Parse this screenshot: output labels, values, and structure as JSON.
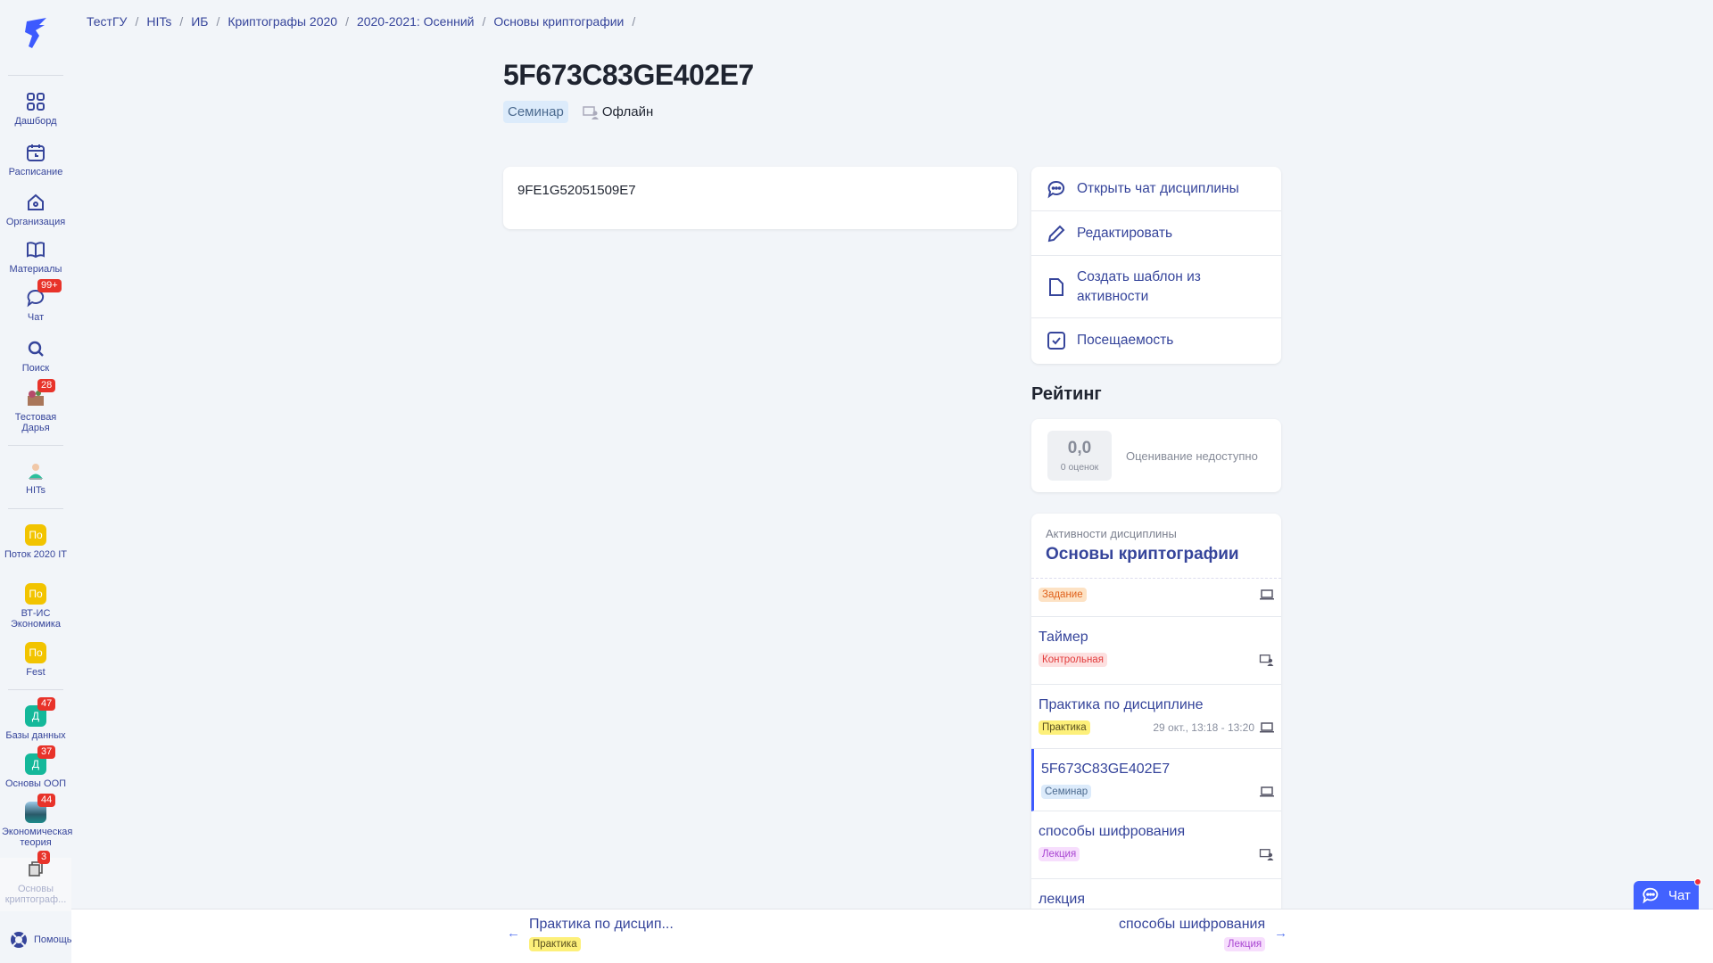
{
  "sidebar": {
    "items": [
      {
        "label": "Дашборд",
        "icon": "dashboard-icon"
      },
      {
        "label": "Расписание",
        "icon": "calendar-icon"
      },
      {
        "label": "Организация",
        "icon": "home-icon"
      },
      {
        "label": "Материалы",
        "icon": "book-icon"
      },
      {
        "label": "Чат",
        "icon": "chat-icon",
        "badge": "99+"
      },
      {
        "label": "Поиск",
        "icon": "search-icon"
      },
      {
        "label": "Тестовая Дарья",
        "icon": "avatar",
        "badge": "28"
      },
      {
        "label": "HITs",
        "icon": "avatar"
      },
      {
        "label": "Поток 2020 IT",
        "short": "По",
        "color": "#f2c400"
      },
      {
        "label": "ВТ-ИС Экономика",
        "short": "По",
        "color": "#f2c400"
      },
      {
        "label": "Fest",
        "short": "По",
        "color": "#f2c400"
      },
      {
        "label": "Базы данных",
        "short": "Д",
        "color": "#14b89a",
        "badge": "47"
      },
      {
        "label": "Основы ООП",
        "short": "Д",
        "color": "#14b89a",
        "badge": "37"
      },
      {
        "label": "Экономическая теория",
        "badge": "44"
      },
      {
        "label": "Основы криптограф...",
        "badge": "3"
      }
    ],
    "help": "Помощь"
  },
  "breadcrumb": [
    "ТестГУ",
    "HITs",
    "ИБ",
    "Криптографы 2020",
    "2020-2021: Осенний",
    "Основы криптографии"
  ],
  "page": {
    "title": "5F673C83GE402E7",
    "type": "Семинар",
    "mode": "Офлайн",
    "content": "9FE1G52051509E7"
  },
  "actions": [
    "Открыть чат дисциплины",
    "Редактировать",
    "Создать шаблон из активности",
    "Посещаемость"
  ],
  "rating": {
    "heading": "Рейтинг",
    "score": "0,0",
    "count": "0 оценок",
    "status": "Оценивание недоступно"
  },
  "activities": {
    "subtitle": "Активности дисциплины",
    "title": "Основы криптографии",
    "items": [
      {
        "title": "",
        "tag": "Задание"
      },
      {
        "title": "Таймер",
        "tag": "Контрольная"
      },
      {
        "title": "Практика по дисциплине",
        "tag": "Практика",
        "time": "29 окт., 13:18 - 13:20"
      },
      {
        "title": "5F673C83GE402E7",
        "tag": "Семинар"
      },
      {
        "title": "способы шифрования",
        "tag": "Лекция"
      },
      {
        "title": "лекция"
      }
    ]
  },
  "nav": {
    "prev": {
      "title": "Практика по дисцип...",
      "tag": "Практика"
    },
    "next": {
      "title": "способы шифрования",
      "tag": "Лекция"
    }
  },
  "chat_button": "Чат",
  "colors": {
    "accent": "#4262ff",
    "link": "#36459b",
    "badge": "#e8332a"
  }
}
